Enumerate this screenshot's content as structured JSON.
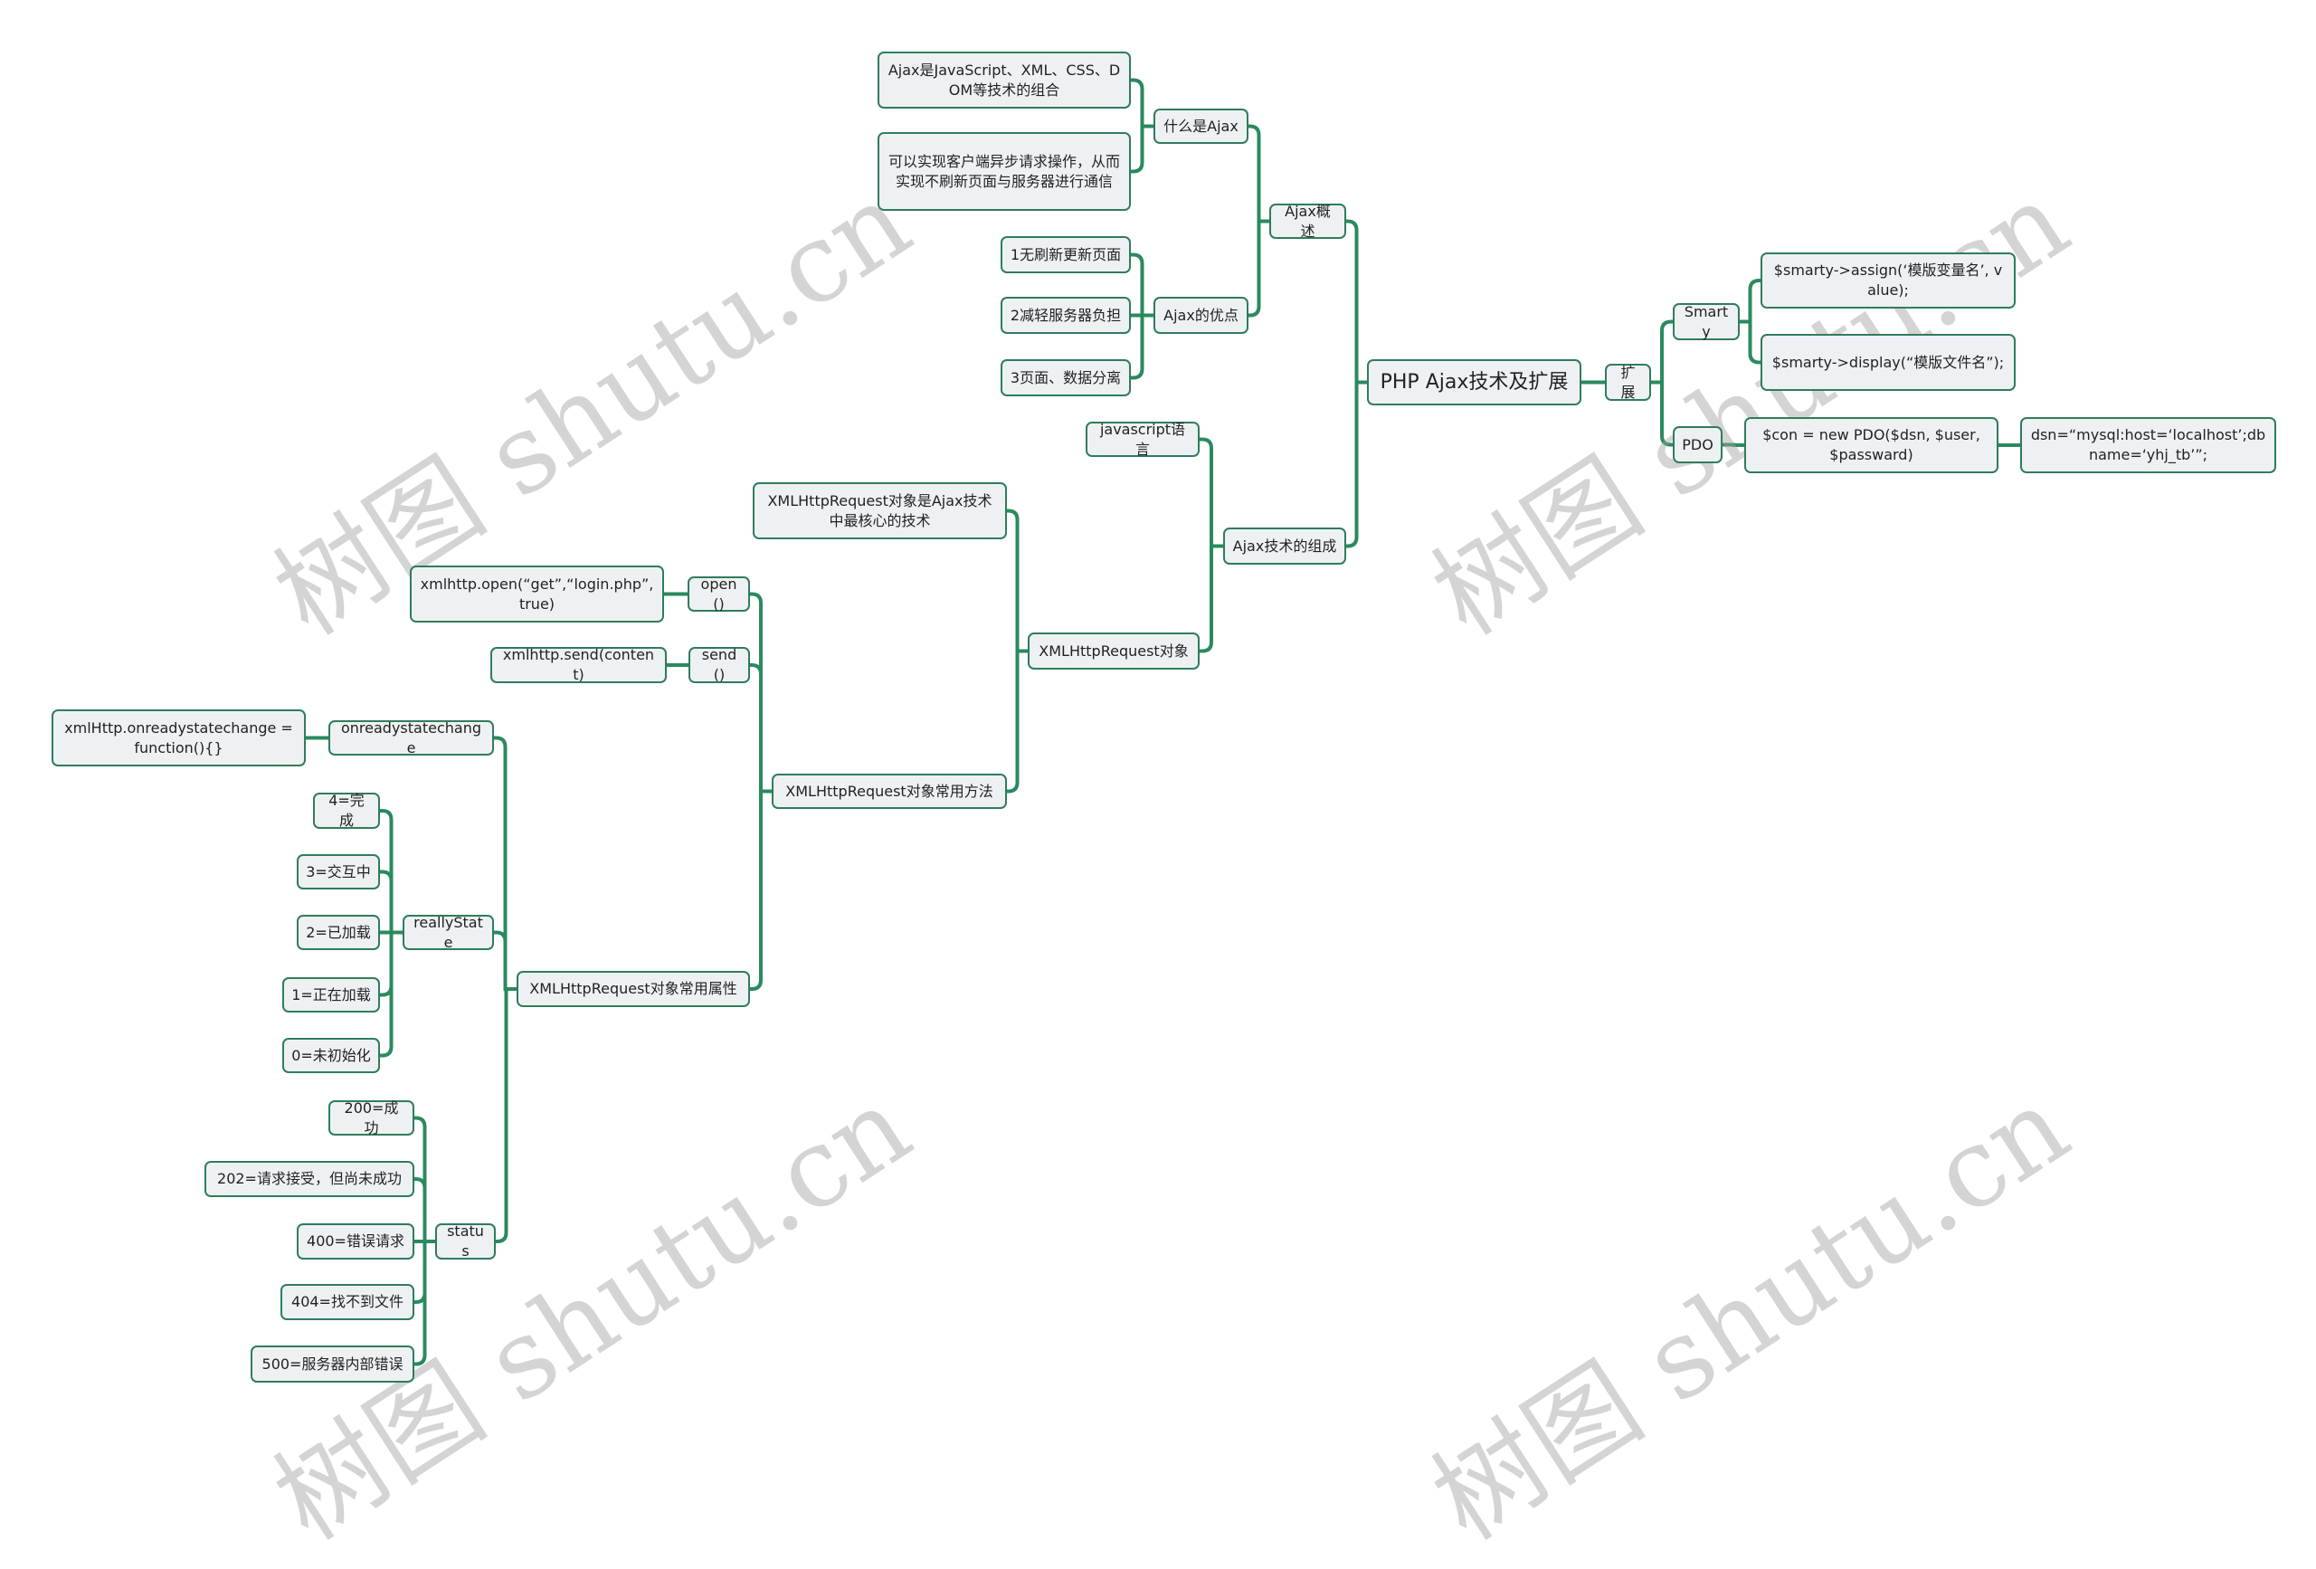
{
  "watermark": "树图 shutu.cn",
  "colors": {
    "line": "#2a8a5e",
    "node_border": "#2f7d5c",
    "node_fill": "#eef1f4"
  },
  "root": {
    "label": "PHP Ajax技术及扩展"
  },
  "nodes": {
    "extend": "扩展",
    "smarty": "Smarty",
    "smarty_assign": "$smarty->assign(‘模版变量名’, value);",
    "smarty_display": "$smarty->display(“模版文件名”);",
    "pdo": "PDO",
    "pdo_con": "$con = new PDO($dsn, $user, $passward)",
    "pdo_dsn": "dsn=“mysql:host=‘localhost’;dbname=‘yhj_tb’”;",
    "overview": "Ajax概述",
    "what_is": "什么是Ajax",
    "what_is_1": "Ajax是JavaScript、XML、CSS、DOM等技术的组合",
    "what_is_2": "可以实现客户端异步请求操作，从而实现不刷新页面与服务器进行通信",
    "advantages": "Ajax的优点",
    "adv_1": "1无刷新更新页面",
    "adv_2": "2减轻服务器负担",
    "adv_3": "3页面、数据分离",
    "composition": "Ajax技术的组成",
    "js_lang": "javascript语言",
    "xhr_object": "XMLHttpRequest对象",
    "xhr_core": "XMLHttpRequest对象是Ajax技术中最核心的技术",
    "xhr_methods": "XMLHttpRequest对象常用方法",
    "open": "open()",
    "open_example": "xmlhttp.open(“get”,“login.php”,true)",
    "send": "send()",
    "send_example": "xmlhttp.send(content)",
    "xhr_props": "XMLHttpRequest对象常用属性",
    "onreadystatechange": "onreadystatechange",
    "onready_example": "xmlHttp.onreadystatechange = function(){}",
    "really_state": "reallyState",
    "rs_4": "4=完成",
    "rs_3": "3=交互中",
    "rs_2": "2=已加载",
    "rs_1": "1=正在加载",
    "rs_0": "0=未初始化",
    "status": "status",
    "st_200": "200=成功",
    "st_202": "202=请求接受，但尚未成功",
    "st_400": "400=错误请求",
    "st_404": "404=找不到文件",
    "st_500": "500=服务器内部错误"
  }
}
